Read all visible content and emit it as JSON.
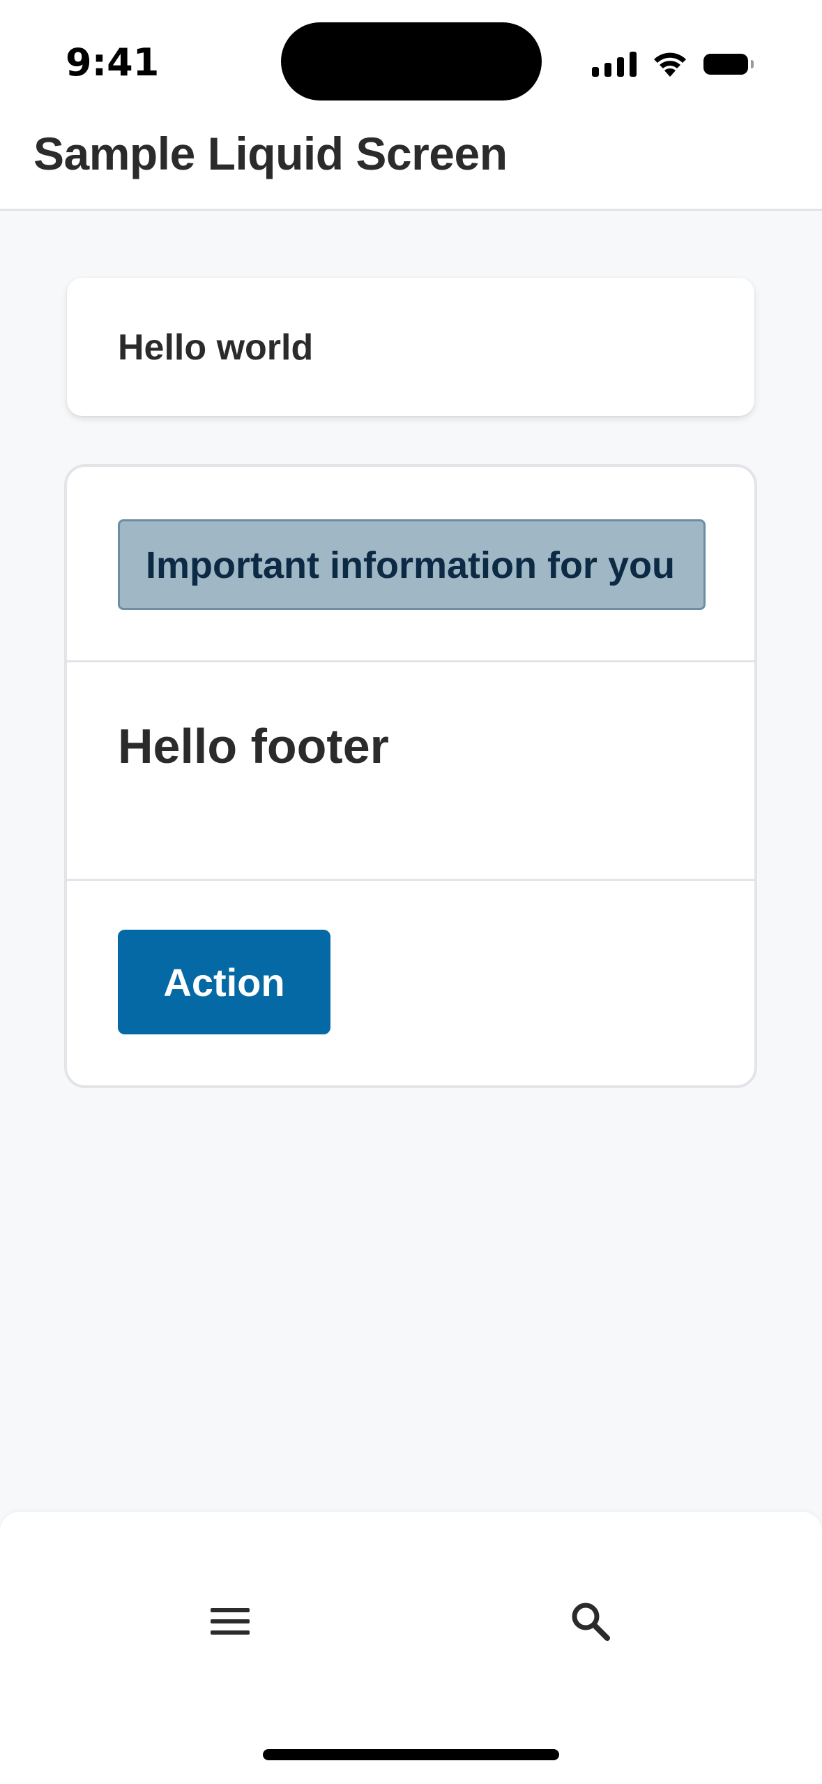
{
  "status_bar": {
    "time": "9:41",
    "icons": [
      "signal-icon",
      "wifi-icon",
      "battery-icon"
    ]
  },
  "header": {
    "title": "Sample Liquid Screen"
  },
  "hello_card": {
    "text": "Hello world"
  },
  "main_card": {
    "info_banner": "Important information for you",
    "footer_text": "Hello footer",
    "action_label": "Action"
  },
  "bottom_nav": {
    "items": [
      {
        "icon": "menu-icon"
      },
      {
        "icon": "search-icon"
      }
    ]
  },
  "colors": {
    "background": "#f7f8fa",
    "primary": "#0469a4",
    "info_bg": "#a0b8c6",
    "info_text": "#0d2a45",
    "text": "#2b2b2b"
  }
}
